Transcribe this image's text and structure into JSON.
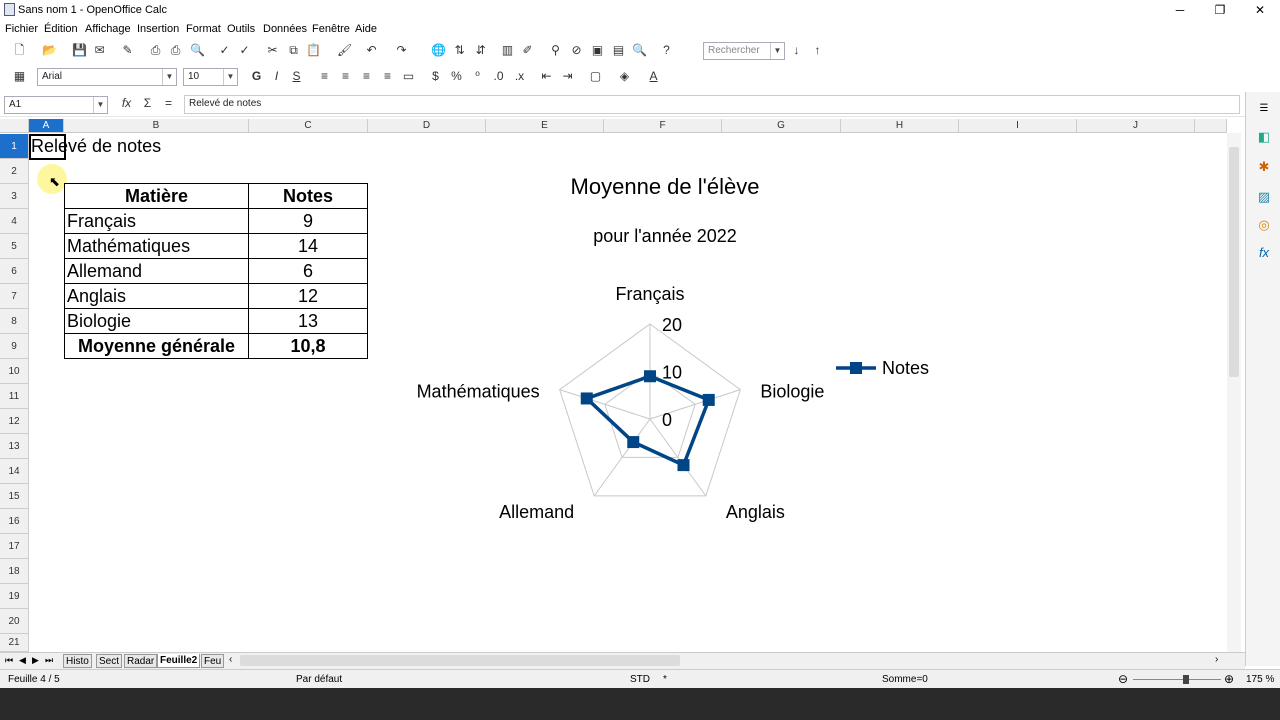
{
  "window": {
    "title": "Sans nom 1 - OpenOffice Calc",
    "minimize": "─",
    "restore": "❐",
    "close": "✕"
  },
  "menu": [
    "Fichier",
    "Édition",
    "Affichage",
    "Insertion",
    "Format",
    "Outils",
    "Données",
    "Fenêtre",
    "Aide"
  ],
  "toolbar": {
    "search_placeholder": "Rechercher",
    "font_name": "Arial",
    "font_size": "10",
    "bold": "G",
    "italic": "I",
    "underline": "S"
  },
  "formula_bar": {
    "cell_ref": "A1",
    "content": "Relevé de notes",
    "equals": "="
  },
  "columns": [
    "A",
    "B",
    "C",
    "D",
    "E",
    "F",
    "G",
    "H",
    "I",
    "J"
  ],
  "rows": [
    "1",
    "2",
    "3",
    "4",
    "5",
    "6",
    "7",
    "8",
    "9",
    "10",
    "11",
    "12",
    "13",
    "14",
    "15",
    "16",
    "17",
    "18",
    "19",
    "20",
    "21"
  ],
  "cells": {
    "a1": "Relevé de notes"
  },
  "grade_table": {
    "headers": [
      "Matière",
      "Notes"
    ],
    "rows": [
      [
        "Français",
        "9"
      ],
      [
        "Mathématiques",
        "14"
      ],
      [
        "Allemand",
        "6"
      ],
      [
        "Anglais",
        "12"
      ],
      [
        "Biologie",
        "13"
      ]
    ],
    "footer": [
      "Moyenne générale",
      "10,8"
    ]
  },
  "chart_data": {
    "type": "radar",
    "title": "Moyenne de l'élève",
    "subtitle": "pour l'année 2022",
    "categories": [
      "Français",
      "Biologie",
      "Anglais",
      "Allemand",
      "Mathématiques"
    ],
    "series": [
      {
        "name": "Notes",
        "values": [
          9,
          13,
          12,
          6,
          14
        ],
        "color": "#004586"
      }
    ],
    "rmax": 20,
    "ticks": [
      "0",
      "10",
      "20"
    ],
    "tick_values": [
      0,
      10,
      20
    ],
    "legend": "right"
  },
  "sheet_tabs": [
    "Histo",
    "Sect",
    "Radar",
    "Feuille2",
    "Feu"
  ],
  "active_tab": "Feuille2",
  "status": {
    "sheet": "Feuille 4 / 5",
    "style": "Par défaut",
    "mode": "STD",
    "modified": "*",
    "sum": "Somme=0",
    "zoom": "175 %"
  }
}
